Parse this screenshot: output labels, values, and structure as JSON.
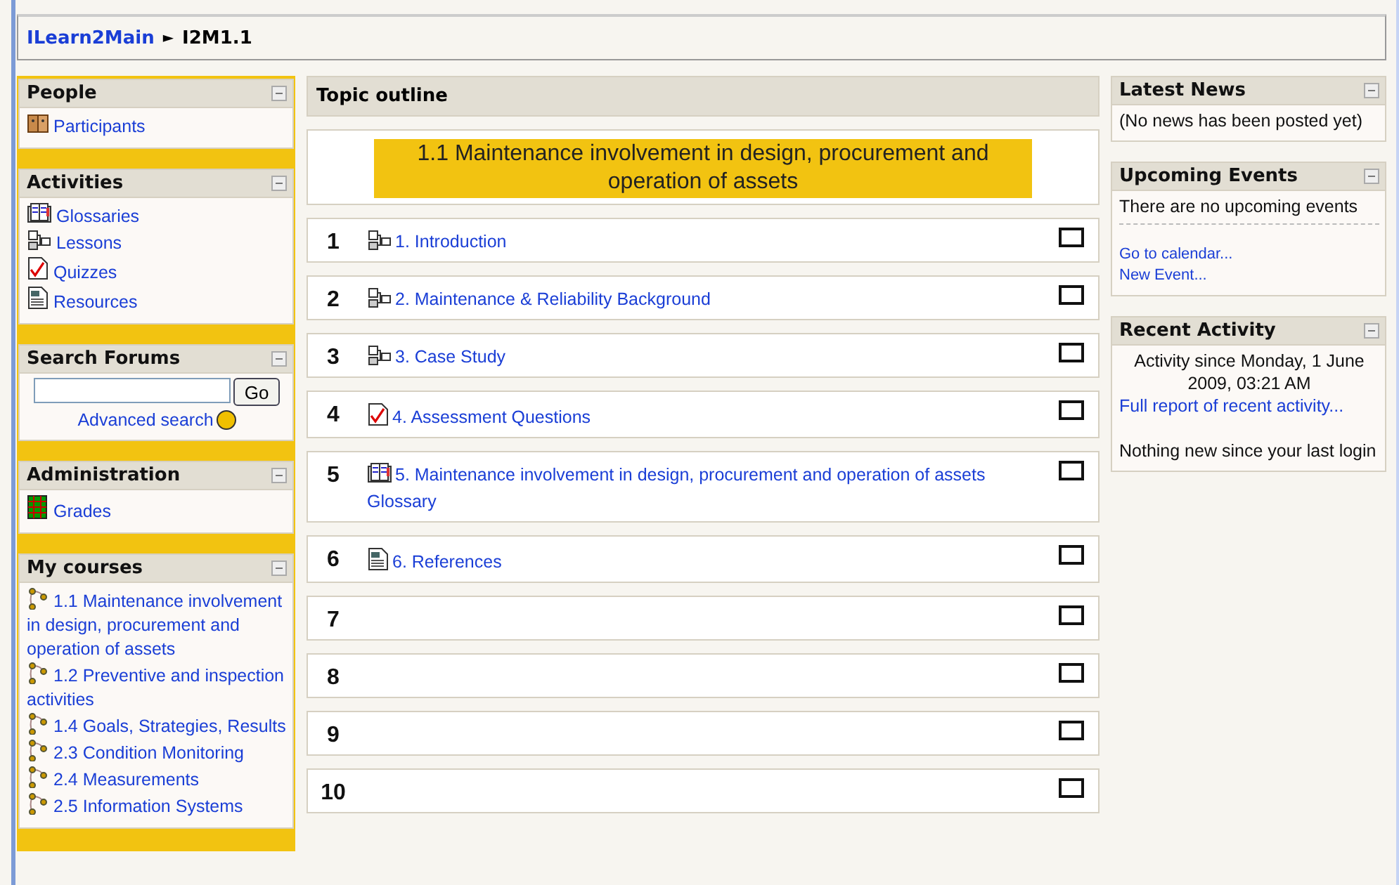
{
  "breadcrumb": {
    "home": "ILearn2Main",
    "separator": "►",
    "current": "I2M1.1"
  },
  "left_blocks": [
    {
      "title": "People",
      "content": [
        {
          "kind": "people",
          "label": "Participants"
        }
      ]
    },
    {
      "title": "Activities",
      "content": [
        {
          "kind": "glossary",
          "label": "Glossaries"
        },
        {
          "kind": "lesson",
          "label": "Lessons"
        },
        {
          "kind": "quiz",
          "label": "Quizzes"
        },
        {
          "kind": "resource",
          "label": "Resources"
        }
      ]
    },
    {
      "title": "Search Forums",
      "content": [
        {
          "kind": "search",
          "button": "Go",
          "link": "Advanced search"
        }
      ]
    },
    {
      "title": "Administration",
      "content": [
        {
          "kind": "grades",
          "label": "Grades"
        }
      ]
    },
    {
      "title": "My courses",
      "content": [
        {
          "kind": "course",
          "label": "1.1 Maintenance involvement in design, procurement and operation of assets"
        },
        {
          "kind": "course",
          "label": "1.2 Preventive and inspection activities"
        },
        {
          "kind": "course",
          "label": "1.4 Goals, Strategies, Results"
        },
        {
          "kind": "course",
          "label": "2.3 Condition Monitoring"
        },
        {
          "kind": "course",
          "label": "2.4 Measurements"
        },
        {
          "kind": "course",
          "label": "2.5 Information Systems"
        }
      ]
    }
  ],
  "topic_outline": {
    "title": "Topic outline",
    "summary": "1.1 Maintenance involvement in design, procurement and operation of assets",
    "sections": [
      {
        "number": "1",
        "items": [
          {
            "kind": "lesson",
            "label": "1. Introduction"
          }
        ]
      },
      {
        "number": "2",
        "items": [
          {
            "kind": "lesson",
            "label": "2. Maintenance & Reliability Background"
          }
        ]
      },
      {
        "number": "3",
        "items": [
          {
            "kind": "lesson",
            "label": "3. Case Study"
          }
        ]
      },
      {
        "number": "4",
        "items": [
          {
            "kind": "quiz",
            "label": "4. Assessment Questions"
          }
        ]
      },
      {
        "number": "5",
        "items": [
          {
            "kind": "glossary",
            "label": "5. Maintenance involvement in design, procurement and operation of assets Glossary"
          }
        ]
      },
      {
        "number": "6",
        "items": [
          {
            "kind": "resource",
            "label": "6. References"
          }
        ]
      },
      {
        "number": "7"
      },
      {
        "number": "8"
      },
      {
        "number": "9"
      },
      {
        "number": "10"
      }
    ]
  },
  "right_blocks": [
    {
      "title": "Latest News",
      "content": [
        {
          "kind": "text",
          "text": "(No news has been posted yet)"
        }
      ]
    },
    {
      "title": "Upcoming Events",
      "content": [
        {
          "kind": "notice",
          "text": "There are no upcoming events"
        },
        {
          "kind": "small-link",
          "label": "Go to calendar..."
        },
        {
          "kind": "small-link",
          "label": "New Event..."
        }
      ]
    },
    {
      "title": "Recent Activity",
      "content": [
        {
          "kind": "centered",
          "text": "Activity since Monday, 1 June 2009, 03:21 AM"
        },
        {
          "kind": "wide-link",
          "label": "Full report of recent activity..."
        },
        {
          "kind": "text",
          "text": "Nothing new since your last login"
        }
      ]
    }
  ]
}
